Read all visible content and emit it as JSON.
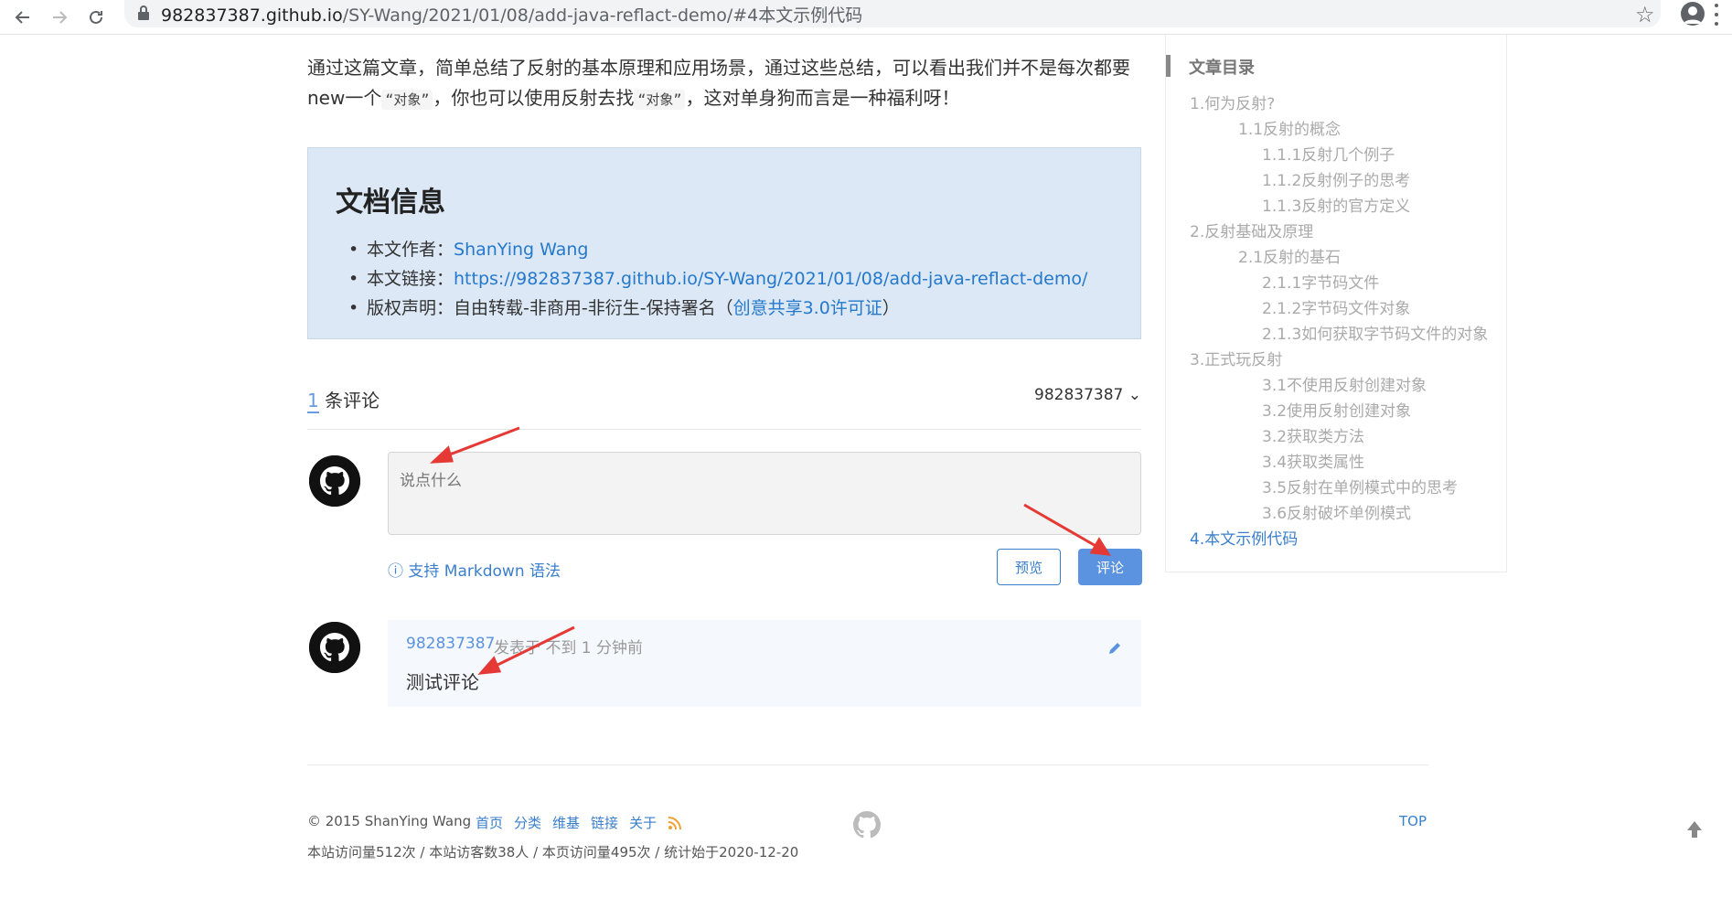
{
  "browser": {
    "url_host": "982837387.github.io",
    "url_path": "/SY-Wang/2021/01/08/add-java-reflact-demo/#4本文示例代码"
  },
  "article": {
    "line1": "通过这篇文章，简单总结了反射的基本原理和应用场景，通过这些总结，可以看出我们并不是每次都要",
    "line2_a": "new一个",
    "code1": "“对象”",
    "line2_b": "，你也可以使用反射去找",
    "code2": "“对象”",
    "line2_c": "，这对单身狗而言是一种福利呀！"
  },
  "doc_info": {
    "title": "文档信息",
    "author_label": "本文作者：",
    "author": "ShanYing Wang",
    "link_label": "本文链接：",
    "link": "https://982837387.github.io/SY-Wang/2021/01/08/add-java-reflact-demo/",
    "license_label": "版权声明：自由转载-非商用-非衍生-保持署名（",
    "license_link": "创意共享3.0许可证",
    "license_tail": "）"
  },
  "comments": {
    "count": "1",
    "count_label": "条评论",
    "user": "982837387 ⌄",
    "placeholder": "说点什么",
    "markdown_hint": "ⓘ 支持 Markdown 语法",
    "preview_btn": "预览",
    "submit_btn": "评论",
    "items": [
      {
        "author": "982837387",
        "meta": "发表于 不到 1 分钟前",
        "body": "测试评论"
      }
    ]
  },
  "toc": {
    "title": "文章目录",
    "items": [
      {
        "label": "1.何为反射?",
        "level": 1
      },
      {
        "label": "1.1反射的概念",
        "level": 2
      },
      {
        "label": "1.1.1反射几个例子",
        "level": 3
      },
      {
        "label": "1.1.2反射例子的思考",
        "level": 3
      },
      {
        "label": "1.1.3反射的官方定义",
        "level": 3
      },
      {
        "label": "2.反射基础及原理",
        "level": 1
      },
      {
        "label": "2.1反射的基石",
        "level": 2
      },
      {
        "label": "2.1.1字节码文件",
        "level": 3
      },
      {
        "label": "2.1.2字节码文件对象",
        "level": 3
      },
      {
        "label": "2.1.3如何获取字节码文件的对象",
        "level": 3
      },
      {
        "label": "3.正式玩反射",
        "level": 1
      },
      {
        "label": "3.1不使用反射创建对象",
        "level": 3
      },
      {
        "label": "3.2使用反射创建对象",
        "level": 3
      },
      {
        "label": "3.2获取类方法",
        "level": 3
      },
      {
        "label": "3.4获取类属性",
        "level": 3
      },
      {
        "label": "3.5反射在单例模式中的思考",
        "level": 3
      },
      {
        "label": "3.6反射破坏单例模式",
        "level": 3
      },
      {
        "label": "4.本文示例代码",
        "level": 1,
        "active": true
      }
    ]
  },
  "footer": {
    "copyright": "© 2015 ShanYing Wang",
    "links": [
      "首页",
      "分类",
      "维基",
      "链接",
      "关于"
    ],
    "stats": "本站访问量512次 / 本站访客数38人 / 本页访问量495次 / 统计始于2020-12-20",
    "top": "TOP"
  },
  "colors": {
    "link": "#2479cc",
    "accent": "#5b93e0",
    "info_bg": "#dce8f5",
    "arrow": "#e53935"
  }
}
